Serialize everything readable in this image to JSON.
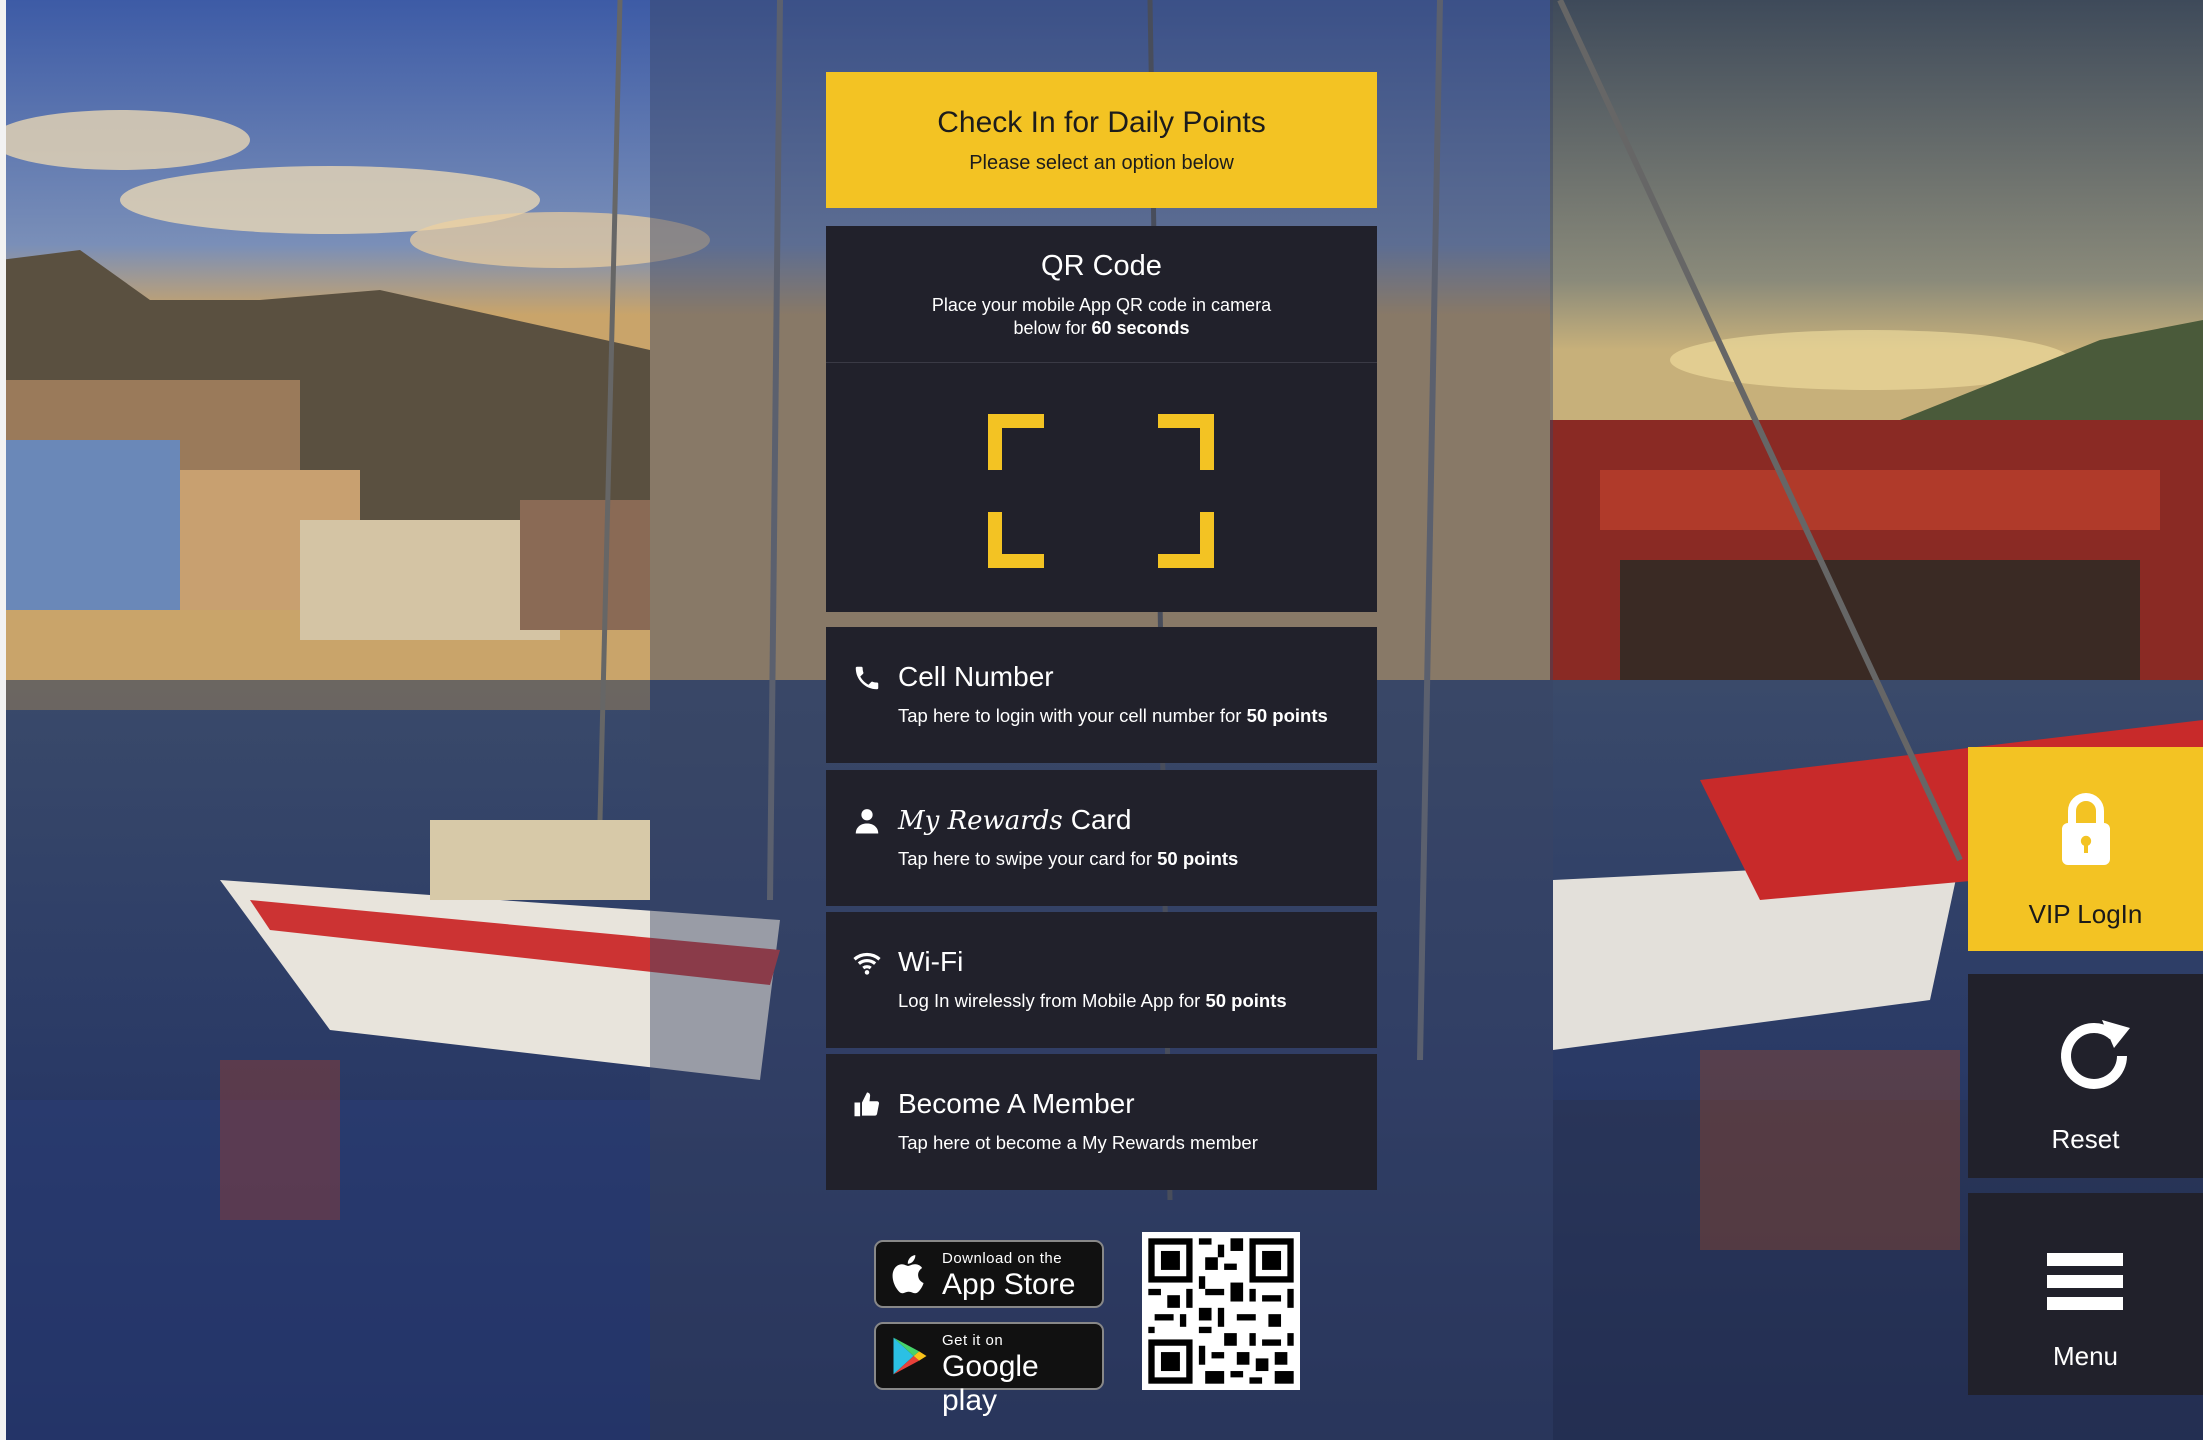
{
  "colors": {
    "accent": "#f3c323",
    "panel": "#21212b",
    "text_light": "#ffffff",
    "text_dark": "#1c1c1c"
  },
  "header": {
    "title": "Check In for Daily Points",
    "subtitle": "Please select an option below"
  },
  "qr": {
    "title": "QR Code",
    "line1": "Place your mobile App QR code in camera",
    "line2_prefix": "below for",
    "line2_bold": "60 seconds"
  },
  "options": [
    {
      "icon": "phone-icon",
      "title": "Cell Number",
      "sub": "Tap here to login with your cell number for",
      "sub_bold": "50 points"
    },
    {
      "icon": "user-icon",
      "title_script": "My Rewards",
      "title": "Card",
      "sub": "Tap here to swipe your card for",
      "sub_bold": "50 points"
    },
    {
      "icon": "wifi-icon",
      "title": "Wi-Fi",
      "sub": "Log In wirelessly from Mobile App for",
      "sub_bold": "50 points"
    },
    {
      "icon": "thumbs-up-icon",
      "title": "Become A Member",
      "sub": "Tap here ot become a My Rewards member"
    }
  ],
  "stores": {
    "apple_small": "Download on the",
    "apple_big": "App Store",
    "google_small": "Get it on",
    "google_big": "Google play"
  },
  "side": {
    "vip": {
      "label": "VIP LogIn",
      "icon": "lock-icon"
    },
    "reset": {
      "label": "Reset",
      "icon": "refresh-icon"
    },
    "menu": {
      "label": "Menu",
      "icon": "hamburger-menu-icon"
    }
  }
}
